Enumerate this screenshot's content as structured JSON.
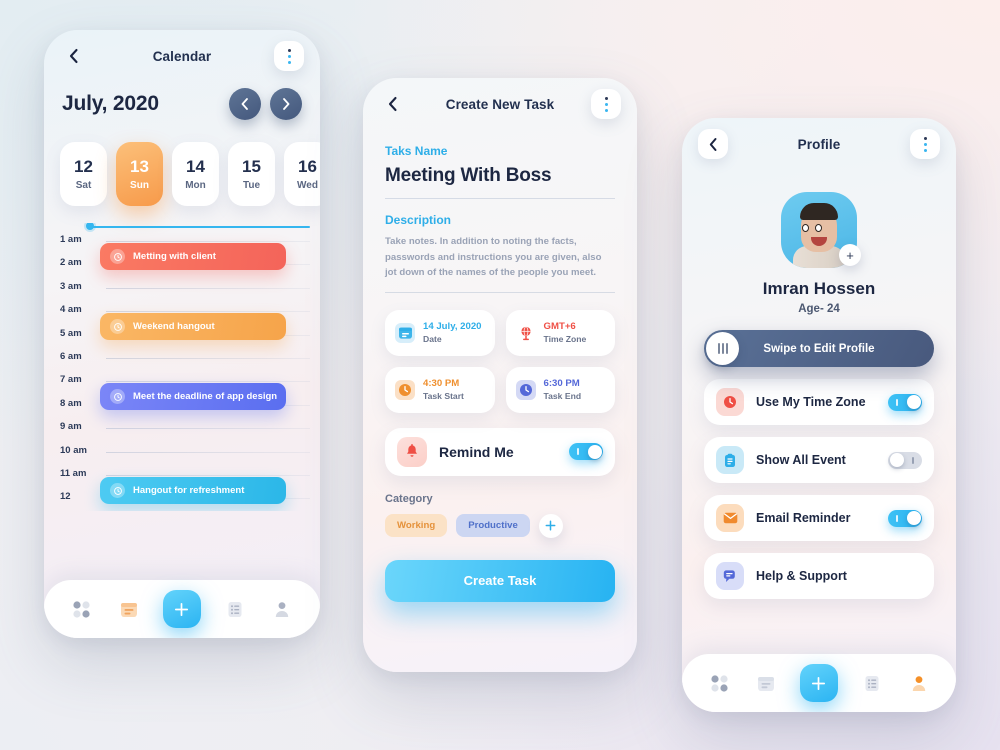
{
  "background": {
    "top_left": "#e3edf2",
    "top_right": "#fceeec",
    "bottom_right": "#e7e2f0"
  },
  "calendar_card": {
    "topbar": {
      "title": "Calendar",
      "back_icon": "chevron-left-icon",
      "menu_icon": "kebab-menu-icon"
    },
    "month": "July, 2020",
    "prev_icon": "chevron-left-icon",
    "next_icon": "chevron-right-icon",
    "days": [
      {
        "num": "12",
        "label": "Sat",
        "active": false
      },
      {
        "num": "13",
        "label": "Sun",
        "active": true
      },
      {
        "num": "14",
        "label": "Mon",
        "active": false
      },
      {
        "num": "15",
        "label": "Tue",
        "active": false
      },
      {
        "num": "16",
        "label": "Wed",
        "active": false
      }
    ],
    "hours": [
      "1 am",
      "2 am",
      "3 am",
      "4 am",
      "5 am",
      "6 am",
      "7 am",
      "8 am",
      "9 am",
      "10 am",
      "11 am",
      "12"
    ],
    "events": [
      {
        "title": "Metting with client",
        "color": "#f4645a",
        "color2": "#fa7a63",
        "hour_index": 0,
        "width": 186
      },
      {
        "title": "Weekend hangout",
        "color": "#f6a44a",
        "color2": "#fab765",
        "hour_index": 3,
        "width": 186
      },
      {
        "title": "Meet the deadline of app design",
        "color": "#5a6ef0",
        "color2": "#7b86f7",
        "hour_index": 6,
        "width": 186
      },
      {
        "title": "Hangout for refreshment",
        "color": "#2bb7e8",
        "color2": "#4ecbf2",
        "hour_index": 10,
        "width": 186
      }
    ],
    "nav": [
      "grid-icon",
      "calendar-icon",
      "add-icon",
      "list-icon",
      "profile-icon"
    ]
  },
  "task_card": {
    "topbar": {
      "title": "Create New Task",
      "back_icon": "chevron-left-icon",
      "menu_icon": "kebab-menu-icon"
    },
    "task_name_label": "Taks Name",
    "task_name_value": "Meeting With Boss",
    "description_label": "Description",
    "description_value": "Take notes. In addition to noting the facts, passwords and instructions you are given, also jot down of the names of the people you meet.",
    "meta": [
      {
        "value": "14 July, 2020",
        "label": "Date",
        "icon": "calendar-icon",
        "value_color": "#2eaee8",
        "icon_bg": "#d7eefa",
        "icon_color": "#2eaee8"
      },
      {
        "value": "GMT+6",
        "label": "Time Zone",
        "icon": "globe-icon",
        "value_color": "#ef4f45",
        "icon_bg": "transparent",
        "icon_color": "#ef4f45"
      },
      {
        "value": "4:30 PM",
        "label": "Task Start",
        "icon": "clock-icon",
        "value_color": "#ef8f2e",
        "icon_bg": "#fbe0c6",
        "icon_color": "#ef8f2e"
      },
      {
        "value": "6:30 PM",
        "label": "Task End",
        "icon": "clock-icon",
        "value_color": "#5468d8",
        "icon_bg": "#d4d9f5",
        "icon_color": "#5468d8"
      }
    ],
    "remind": {
      "label": "Remind Me",
      "icon": "bell-icon",
      "toggle_on": true
    },
    "category_label": "Category",
    "categories": [
      {
        "label": "Working",
        "style": "work"
      },
      {
        "label": "Productive",
        "style": "prod"
      }
    ],
    "add_category_icon": "plus-icon",
    "cta_label": "Create Task"
  },
  "profile_card": {
    "topbar": {
      "title": "Profile",
      "back_icon": "chevron-left-icon",
      "menu_icon": "kebab-menu-icon"
    },
    "avatar_icon": "avatar-photo",
    "avatar_add_icon": "plus-icon",
    "name": "Imran Hossen",
    "age": "Age- 24",
    "swipe_label": "Swipe to Edit Profile",
    "swipe_handle_icon": "drag-handle-icon",
    "settings": [
      {
        "label": "Use My Time Zone",
        "icon": "clock-icon",
        "icon_bg": "#fbd9d4",
        "icon_color": "#ef4f45",
        "toggle": "on"
      },
      {
        "label": "Show All Event",
        "icon": "clipboard-icon",
        "icon_bg": "#c9e9f7",
        "icon_color": "#2eaee8",
        "toggle": "off"
      },
      {
        "label": "Email Reminder",
        "icon": "mail-icon",
        "icon_bg": "#fcdcbd",
        "icon_color": "#f08a2e",
        "toggle": "on"
      },
      {
        "label": "Help & Support",
        "icon": "chat-icon",
        "icon_bg": "#d8ddf8",
        "icon_color": "#5468d8",
        "toggle": "none"
      }
    ],
    "nav": [
      "grid-icon",
      "calendar-icon",
      "add-icon",
      "list-icon",
      "profile-icon"
    ]
  }
}
